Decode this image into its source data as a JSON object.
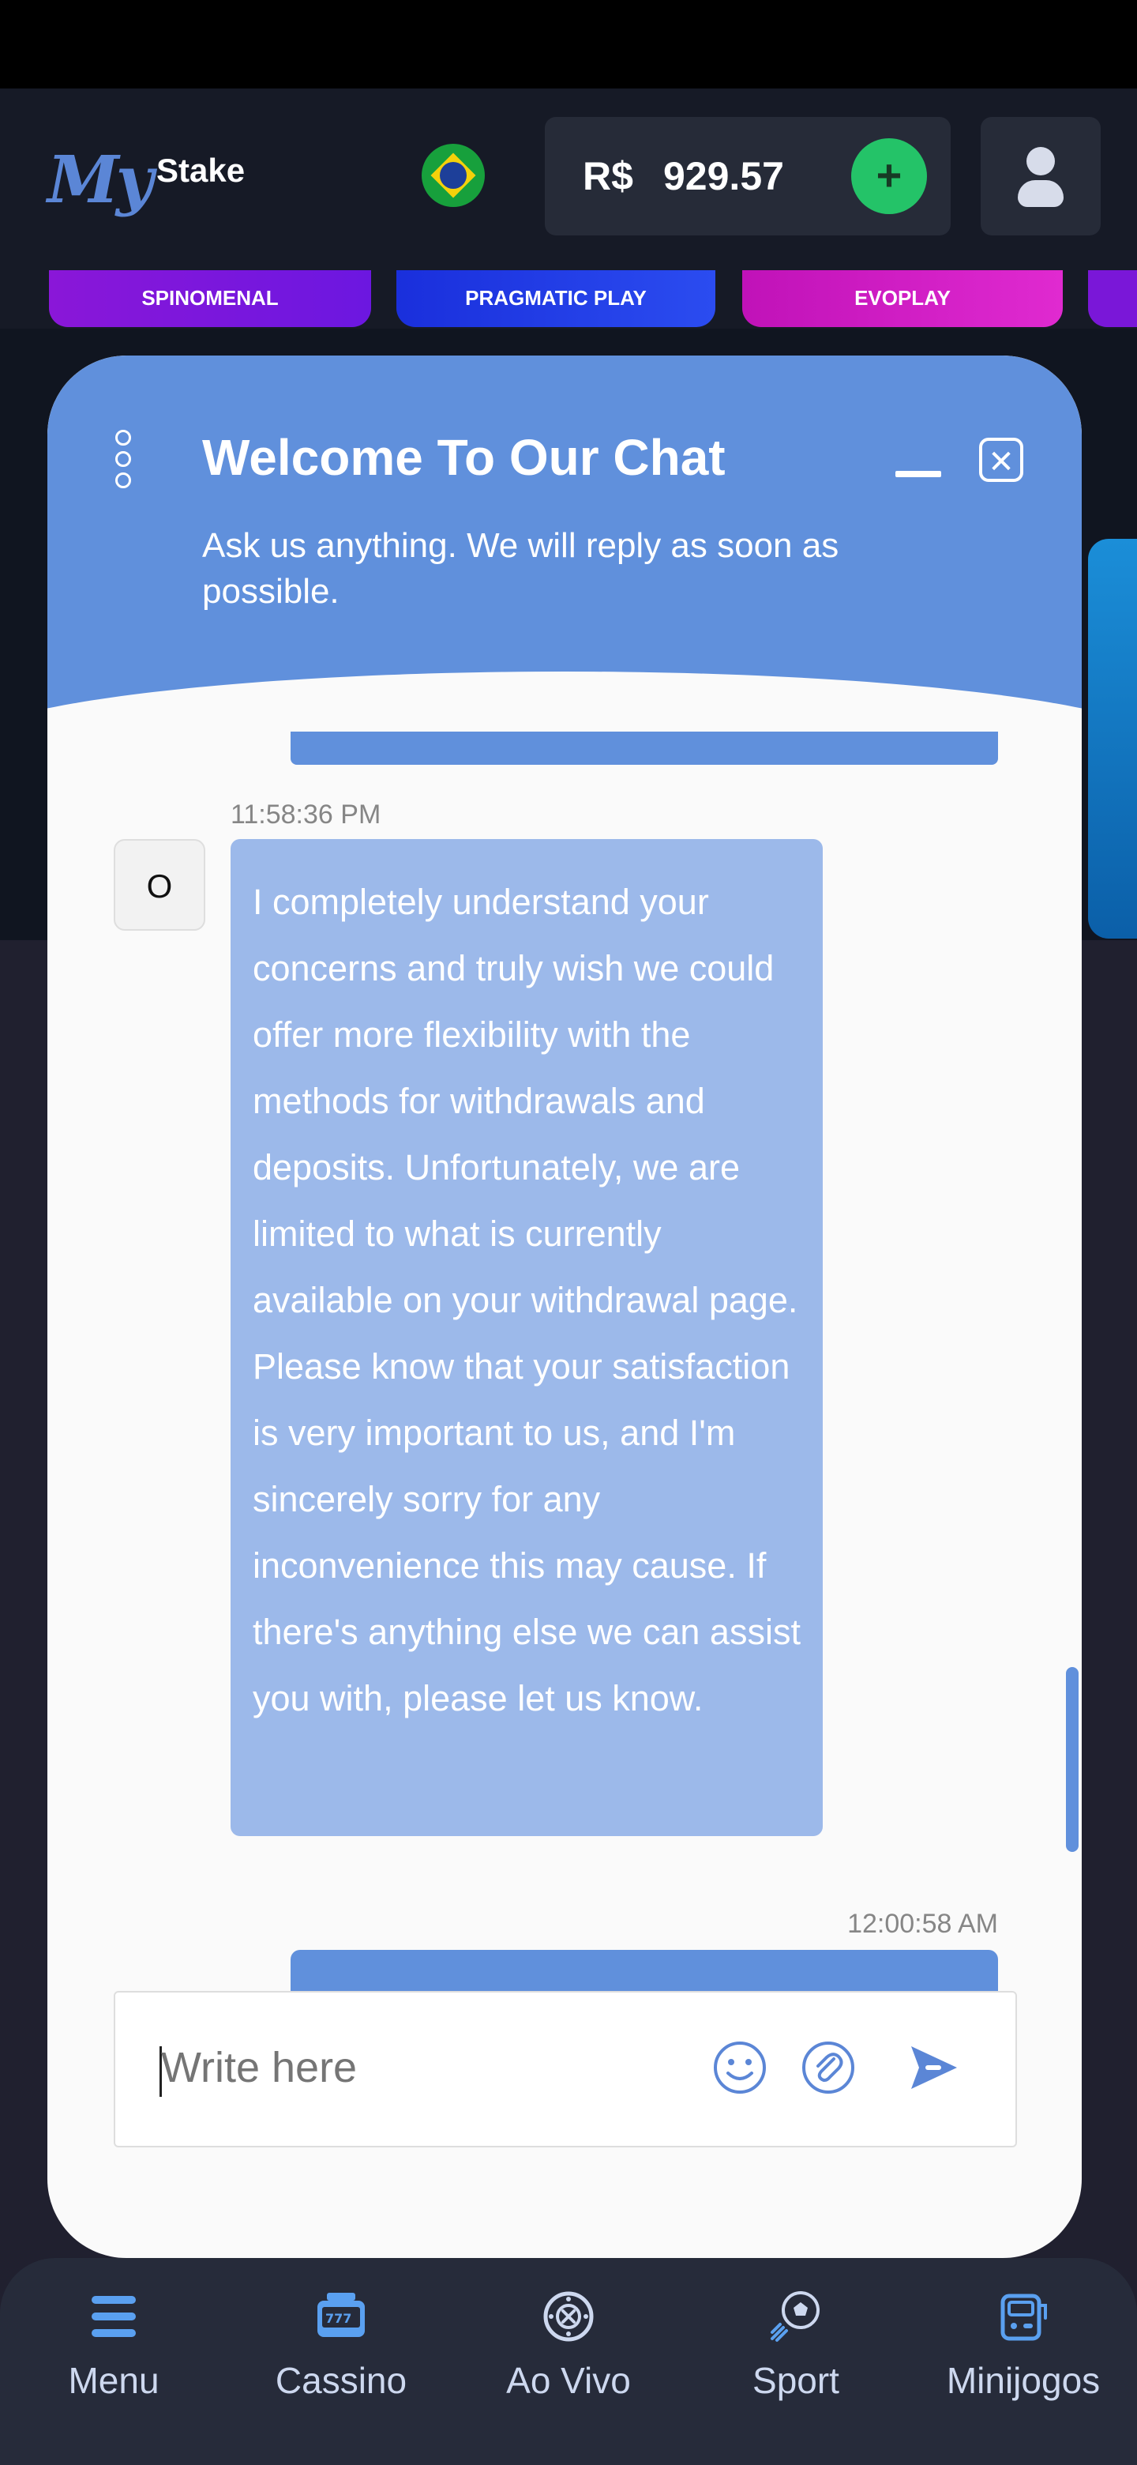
{
  "header": {
    "logo_my": "My",
    "logo_stake": "Stake",
    "currency": "R$",
    "balance": "929.57",
    "add_label": "+"
  },
  "providers": [
    "SPINOMENAL",
    "PRAGMATIC PLAY",
    "EVOPLAY"
  ],
  "chat": {
    "title": "Welcome To Our Chat",
    "subtitle": "Ask us anything. We will reply as soon as possible.",
    "close_label": "✕",
    "messages": [
      {
        "time": "11:58:36 PM",
        "avatar": "O",
        "text": "I completely understand your concerns and truly wish we could offer more flexibility with the methods for withdrawals and deposits. Unfortunately, we are limited to what is currently available on your withdrawal page. Please know that your satisfaction is very important to us, and I'm sincerely sorry for any inconvenience this may cause. If there's anything else we can assist you with, please let us know."
      },
      {
        "time": "12:00:58 AM"
      }
    ],
    "input_placeholder": "Write here"
  },
  "bottom_nav": [
    {
      "label": "Menu",
      "icon": "hamburger-icon"
    },
    {
      "label": "Cassino",
      "icon": "slot-machine-icon"
    },
    {
      "label": "Ao Vivo",
      "icon": "roulette-icon"
    },
    {
      "label": "Sport",
      "icon": "soccer-ball-icon"
    },
    {
      "label": "Minijogos",
      "icon": "arcade-icon"
    }
  ],
  "colors": {
    "chat_accent": "#6090dc",
    "agent_bubble": "#9cb9ea",
    "add_button": "#24c368",
    "nav_icon": "#5aa0f0"
  }
}
